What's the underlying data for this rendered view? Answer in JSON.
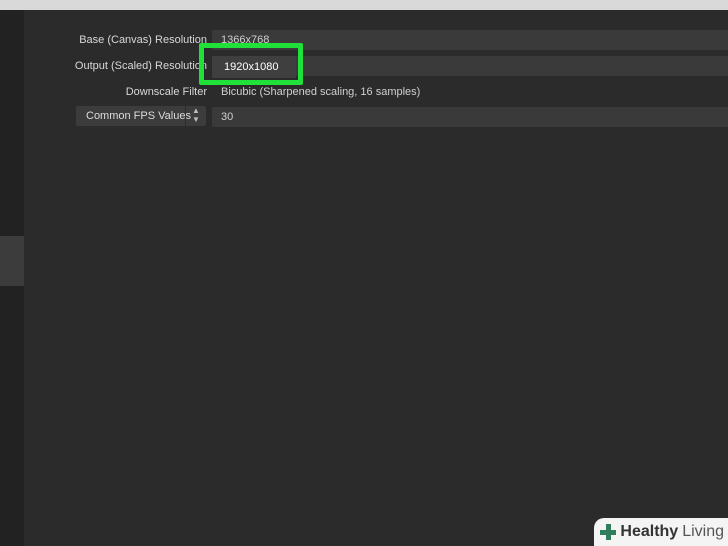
{
  "settings": {
    "base_resolution": {
      "label": "Base (Canvas) Resolution",
      "value": "1366x768"
    },
    "output_resolution": {
      "label": "Output (Scaled) Resolution",
      "value": "1920x1080"
    },
    "downscale_filter": {
      "label": "Downscale Filter",
      "value": "Bicubic (Sharpened scaling, 16 samples)"
    },
    "fps": {
      "label": "Common FPS Values",
      "value": "30"
    }
  },
  "watermark": {
    "bold": "Healthy",
    "regular": "Living"
  },
  "colors": {
    "background": "#2b2b2b",
    "highlight": "#22e03a",
    "brand": "#2f7d5a"
  }
}
